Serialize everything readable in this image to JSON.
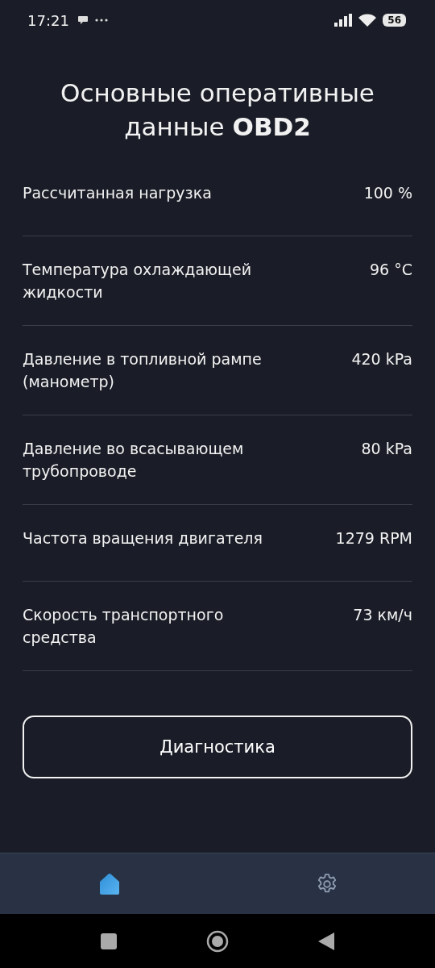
{
  "status_bar": {
    "time": "17:21",
    "battery": "56"
  },
  "title": "Основные оперативные данные **OBD2**",
  "rows": [
    {
      "label": "Рассчитанная нагрузка",
      "value": "100 %"
    },
    {
      "label": "Температура охлаждающей жидкости",
      "value": "96 °C"
    },
    {
      "label": "Давление в топливной рампе (манометр)",
      "value": "420 kPa"
    },
    {
      "label": "Давление во всасывающем трубопроводе",
      "value": "80 kPa"
    },
    {
      "label": "Частота вращения двигателя",
      "value": "1279 RPM"
    },
    {
      "label": "Скорость транспортного средства",
      "value": "73 км/ч"
    }
  ],
  "button": "Диагностика",
  "nav": [
    {
      "kind": "home",
      "selected": true
    },
    {
      "kind": "settings",
      "selected": false
    }
  ]
}
